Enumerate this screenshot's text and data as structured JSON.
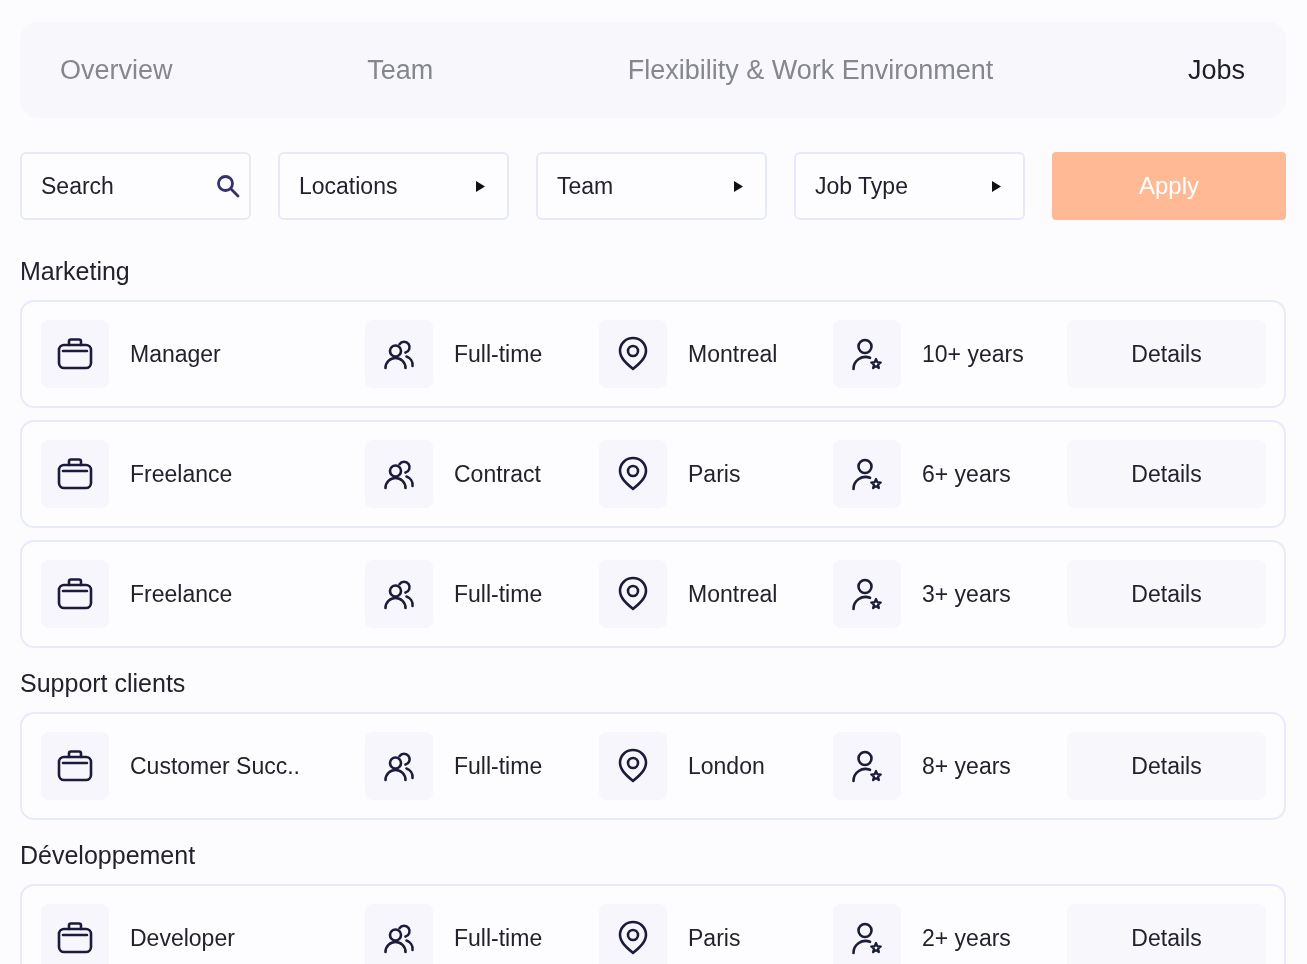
{
  "tabs": [
    {
      "label": "Overview",
      "selected": false
    },
    {
      "label": "Team",
      "selected": false
    },
    {
      "label": "Flexibility & Work Environment",
      "selected": false
    },
    {
      "label": "Jobs",
      "selected": true
    }
  ],
  "filters": {
    "search": {
      "placeholder": "Search"
    },
    "dropdowns": [
      "Locations",
      "Team",
      "Job Type"
    ],
    "apply_button": "Apply"
  },
  "sections": [
    {
      "title": "Marketing",
      "jobs": [
        {
          "title": "Manager",
          "contract": "Full-time",
          "location": "Montreal",
          "experience": "10+ years",
          "button": "Details"
        },
        {
          "title": "Freelance",
          "contract": "Contract",
          "location": "Paris",
          "experience": "6+ years",
          "button": "Details"
        },
        {
          "title": "Freelance",
          "contract": "Full-time",
          "location": "Montreal",
          "experience": "3+ years",
          "button": "Details"
        }
      ]
    },
    {
      "title": "Support clients",
      "jobs": [
        {
          "title": "Customer Succ..",
          "contract": "Full-time",
          "location": "London",
          "experience": "8+ years",
          "button": "Details"
        }
      ]
    },
    {
      "title": "Développement",
      "jobs": [
        {
          "title": "Developer",
          "contract": "Full-time",
          "location": "Paris",
          "experience": "2+ years",
          "button": "Details"
        }
      ]
    }
  ]
}
